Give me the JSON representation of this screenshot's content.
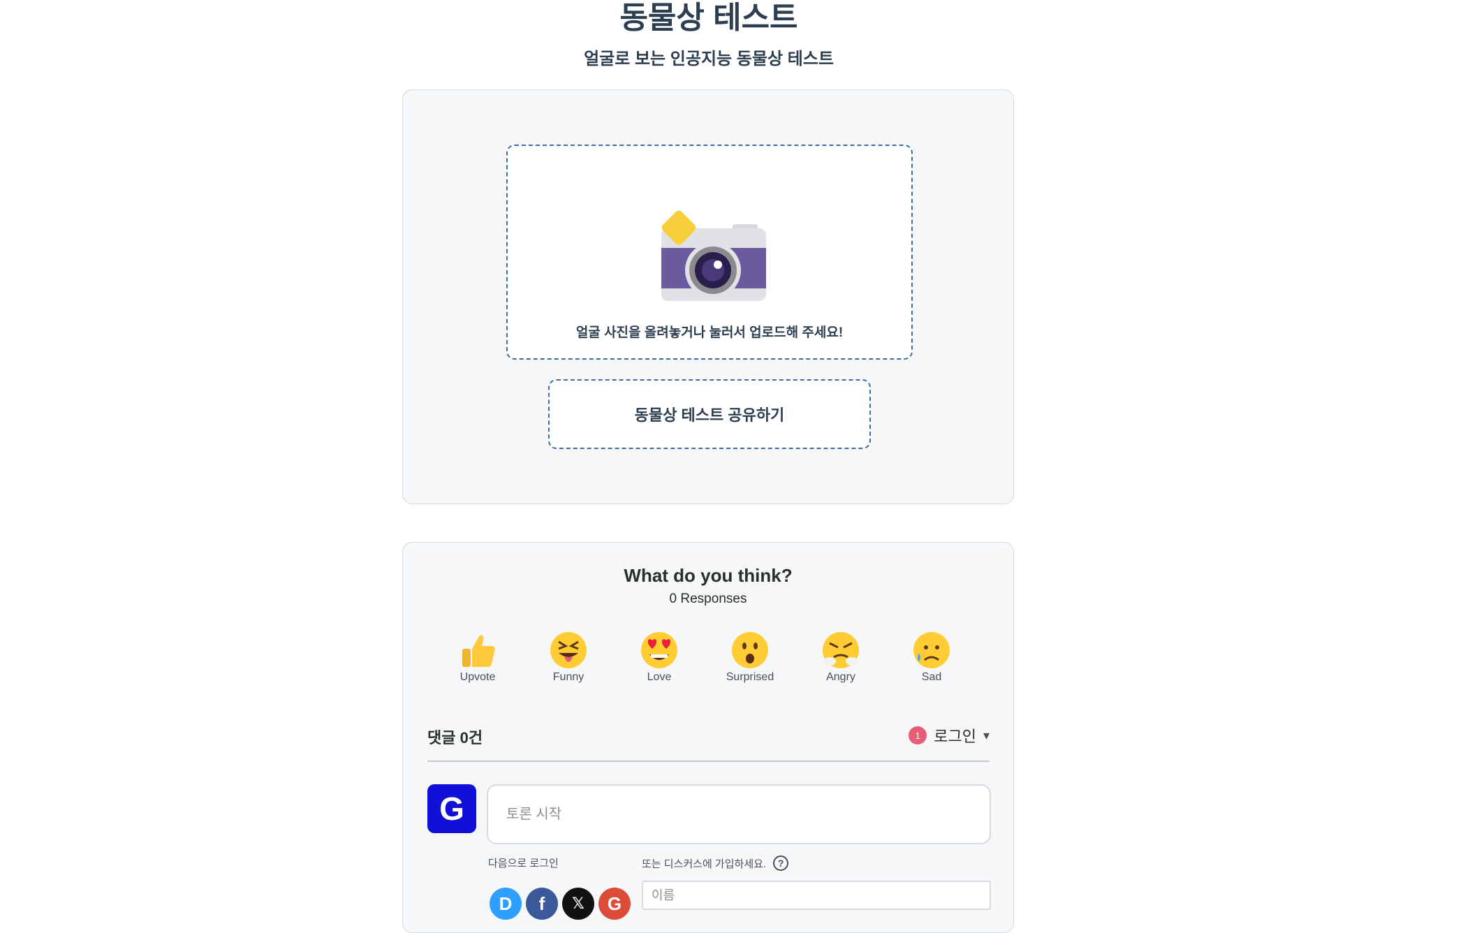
{
  "header": {
    "title": "동물상 테스트",
    "subtitle": "얼굴로 보는 인공지능 동물상 테스트"
  },
  "upload": {
    "icon": "camera-icon",
    "text": "얼굴 사진을 올려놓거나 눌러서 업로드해 주세요!",
    "share_label": "동물상 테스트 공유하기"
  },
  "disqus": {
    "question": "What do you think?",
    "responses": "0 Responses",
    "reactions": [
      {
        "label": "Upvote",
        "icon": "thumbs-up-icon"
      },
      {
        "label": "Funny",
        "icon": "tongue-face-icon"
      },
      {
        "label": "Love",
        "icon": "heart-eyes-icon"
      },
      {
        "label": "Surprised",
        "icon": "surprised-face-icon"
      },
      {
        "label": "Angry",
        "icon": "angry-face-icon"
      },
      {
        "label": "Sad",
        "icon": "sad-face-icon"
      }
    ],
    "comments_count": "댓글 0건",
    "notification_count": "1",
    "login_label": "로그인",
    "login_caret": "▾",
    "avatar_letter": "G",
    "comment_placeholder": "토론 시작",
    "login_with": "다음으로 로그인",
    "signup_text": "또는 디스커스에 가입하세요.",
    "help": "?",
    "social": [
      {
        "letter": "D",
        "color": "#2e9fff"
      },
      {
        "letter": "f",
        "color": "#3b5998"
      },
      {
        "letter": "𝕏",
        "color": "#111111"
      },
      {
        "letter": "G",
        "color": "#dd4b39"
      }
    ],
    "name_placeholder": "이름"
  },
  "colors": {
    "title_text": "#2c3e50",
    "dashed_border": "#3a6ea5",
    "card_bg": "#f5f7f9",
    "google_avatar": "#1010d8"
  }
}
